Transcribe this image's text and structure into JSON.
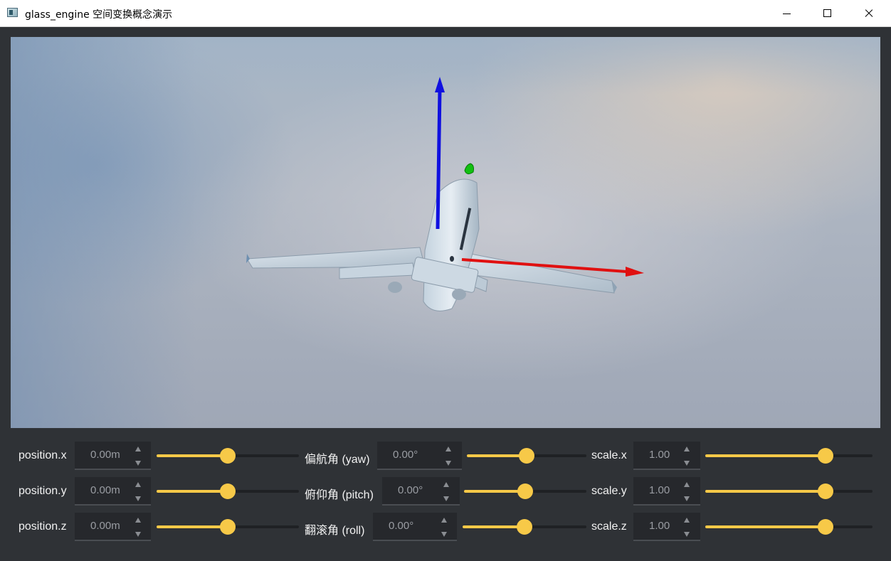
{
  "window": {
    "title": "glass_engine 空间变换概念演示"
  },
  "icons": {
    "app": "app-window-icon",
    "minimize": "minimize-icon",
    "maximize": "maximize-icon",
    "close": "close-icon"
  },
  "colors": {
    "accent": "#f7c948",
    "axis_x": "#e01010",
    "axis_y": "#11c011",
    "axis_z": "#1010e0",
    "panel_bg": "#2f3236"
  },
  "controls": {
    "position_x": {
      "label": "position.x",
      "value": "0.00m",
      "slider": 0.5
    },
    "position_y": {
      "label": "position.y",
      "value": "0.00m",
      "slider": 0.5
    },
    "position_z": {
      "label": "position.z",
      "value": "0.00m",
      "slider": 0.5
    },
    "yaw": {
      "label": "偏航角 (yaw)",
      "value": "0.00°",
      "slider": 0.5
    },
    "pitch": {
      "label": "俯仰角 (pitch)",
      "value": "0.00°",
      "slider": 0.5
    },
    "roll": {
      "label": "翻滚角 (roll)",
      "value": "0.00°",
      "slider": 0.5
    },
    "scale_x": {
      "label": "scale.x",
      "value": "1.00",
      "slider": 0.72
    },
    "scale_y": {
      "label": "scale.y",
      "value": "1.00",
      "slider": 0.72
    },
    "scale_z": {
      "label": "scale.z",
      "value": "1.00",
      "slider": 0.72
    }
  }
}
